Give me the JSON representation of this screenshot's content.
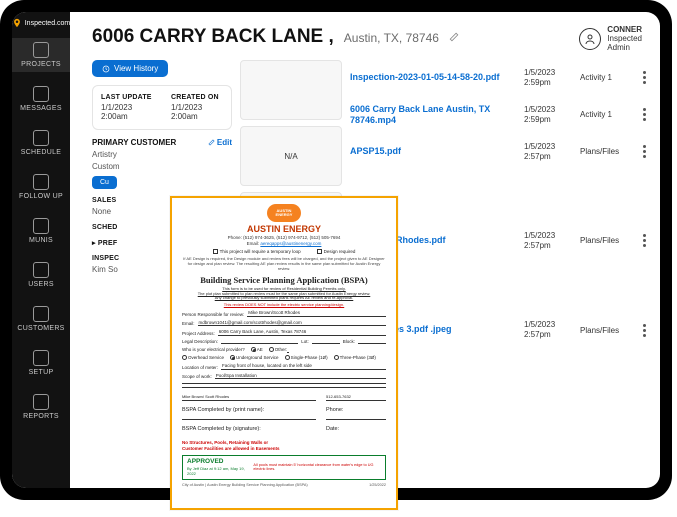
{
  "brand": "Inspected.com",
  "user": {
    "name": "CONNER",
    "role1": "Inspected",
    "role2": "Admin"
  },
  "page": {
    "title": "6006 CARRY BACK LANE ,",
    "subtitle": "Austin, TX, 78746"
  },
  "sidebar": {
    "items": [
      {
        "label": "PROJECTS"
      },
      {
        "label": "MESSAGES"
      },
      {
        "label": "SCHEDULE"
      },
      {
        "label": "FOLLOW UP"
      },
      {
        "label": "MUNIS"
      },
      {
        "label": "USERS"
      },
      {
        "label": "CUSTOMERS"
      },
      {
        "label": "SETUP"
      },
      {
        "label": "REPORTS"
      }
    ]
  },
  "actions": {
    "view_history": "View History",
    "customer_btn": "Cu",
    "edit": "Edit"
  },
  "info": {
    "last_update_lbl": "LAST UPDATE",
    "last_update": "1/1/2023 2:00am",
    "created_lbl": "CREATED ON",
    "created": "1/1/2023 2:00am",
    "primary_customer_lbl": "PRIMARY CUSTOMER",
    "artistry": "Artistry",
    "custom": "Custom",
    "sales_lbl": "SALES",
    "sales_val": "None",
    "sched_lbl": "SCHED",
    "pref_lbl": "▸ PREF",
    "inspec_lbl": "INSPEC",
    "inspec_val": "Kim So"
  },
  "thumbs": {
    "na": "N/A"
  },
  "files": [
    {
      "name": "Inspection-2023-01-05-14-58-20.pdf",
      "date": "1/5/2023",
      "time": "2:59pm",
      "cat": "Activity 1"
    },
    {
      "name": "6006 Carry Back Lane Austin, TX 78746.mp4",
      "date": "1/5/2023",
      "time": "2:59pm",
      "cat": "Activity 1"
    },
    {
      "name": "APSP15.pdf",
      "date": "1/5/2023",
      "time": "2:57pm",
      "cat": "Plans/Files"
    },
    {
      "name": "Pool Spec Rhodes.pdf",
      "date": "1/5/2023",
      "time": "2:57pm",
      "cat": "Plans/Files"
    },
    {
      "name": "scott rhodes 3.pdf .jpeg",
      "date": "1/5/2023",
      "time": "2:57pm",
      "cat": "Plans/Files"
    }
  ],
  "doc": {
    "org": "AUSTIN ENERGY",
    "phone": "Phone: (512) 974-3625, (512) 974-9712, (512) 505-7694",
    "email_lbl": "Email:",
    "email": "aereqapps@austinenergy.com",
    "chk1": "This project will require a temporary loop",
    "chk2": "Design required",
    "disc": "If AE Design is required, the Design module and review fees will be charged, and the project given to AE Designer for design and plan review. The resulting AE plan review results in the same plan submitted for Austin Energy review.",
    "bspa": "Building Service Planning Application (BSPA)",
    "bspa_sub1": "This form is to be used for review of Residential Building Permits only.",
    "bspa_sub2": "The plot plan submitted to plan review must be the same plan submitted for Austin Energy review.",
    "bspa_sub3": "Any change to previously submitted plans requires AE review and re-approval.",
    "bspa_warn": "This review DOES NOT include the electric service planning/design.",
    "f_person_lbl": "Person Responsible for review:",
    "f_person": "Mike Brown/Scott Rhodes",
    "f_email_lbl": "Email:",
    "f_email": "mdbrown1041@gmail.com/scottrhodes@gmail.com",
    "f_addr_lbl": "Project Address:",
    "f_addr": "6006 Carry Back Lane, Austin, Texas 78746",
    "f_legal_lbl": "Legal Description:",
    "f_lot_lbl": "Lot:",
    "f_block_lbl": "Block:",
    "q_provider": "Who is your electrical provider?",
    "r_ae": "AE",
    "r_other": "Other:",
    "svc_overhead": "Overhead Service",
    "svc_under": "Underground Service",
    "svc_single": "Single-Phase (1Ø)",
    "svc_three": "Three-Phase (3Ø)",
    "f_meter_lbl": "Location of meter:",
    "f_meter": "Facing front of house, located on the left side",
    "f_scope_lbl": "Scope of work:",
    "f_scope": "Pool/Spa Installation",
    "sig_name": "Mike Brown/ Scott Rhodes",
    "sig_phone": "512-653-7632",
    "sig_completed_print": "BSPA Completed by (print name):",
    "sig_phone_lbl": "Phone:",
    "sig_completed_sign": "BSPA Completed by (signature):",
    "sig_date_lbl": "Date:",
    "red1": "No Structures, Pools, Retaining Walls or",
    "red2": "Customer Facilities are allowed in Easements",
    "stamp": "APPROVED",
    "stamp_by": "By Jeff Diaz at 9:12 am, May 19, 2022",
    "approval_note": "All pools must maintain 5' horizontal clearance from water's edge to UG electric lines.",
    "foot_left": "City of Austin | Austin Energy Building Service Planning Application (BSPA)",
    "foot_right": "1/25/2022"
  }
}
